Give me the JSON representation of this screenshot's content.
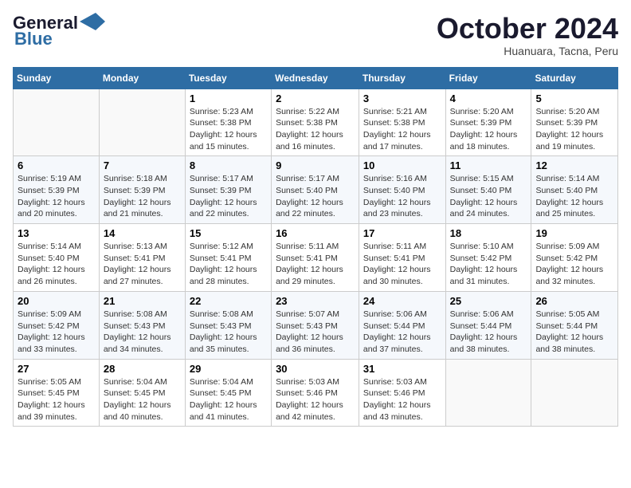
{
  "header": {
    "logo_line1": "General",
    "logo_line2": "Blue",
    "month": "October 2024",
    "location": "Huanuara, Tacna, Peru"
  },
  "weekdays": [
    "Sunday",
    "Monday",
    "Tuesday",
    "Wednesday",
    "Thursday",
    "Friday",
    "Saturday"
  ],
  "weeks": [
    [
      {
        "day": "",
        "sunrise": "",
        "sunset": "",
        "daylight": ""
      },
      {
        "day": "",
        "sunrise": "",
        "sunset": "",
        "daylight": ""
      },
      {
        "day": "1",
        "sunrise": "Sunrise: 5:23 AM",
        "sunset": "Sunset: 5:38 PM",
        "daylight": "Daylight: 12 hours and 15 minutes."
      },
      {
        "day": "2",
        "sunrise": "Sunrise: 5:22 AM",
        "sunset": "Sunset: 5:38 PM",
        "daylight": "Daylight: 12 hours and 16 minutes."
      },
      {
        "day": "3",
        "sunrise": "Sunrise: 5:21 AM",
        "sunset": "Sunset: 5:38 PM",
        "daylight": "Daylight: 12 hours and 17 minutes."
      },
      {
        "day": "4",
        "sunrise": "Sunrise: 5:20 AM",
        "sunset": "Sunset: 5:39 PM",
        "daylight": "Daylight: 12 hours and 18 minutes."
      },
      {
        "day": "5",
        "sunrise": "Sunrise: 5:20 AM",
        "sunset": "Sunset: 5:39 PM",
        "daylight": "Daylight: 12 hours and 19 minutes."
      }
    ],
    [
      {
        "day": "6",
        "sunrise": "Sunrise: 5:19 AM",
        "sunset": "Sunset: 5:39 PM",
        "daylight": "Daylight: 12 hours and 20 minutes."
      },
      {
        "day": "7",
        "sunrise": "Sunrise: 5:18 AM",
        "sunset": "Sunset: 5:39 PM",
        "daylight": "Daylight: 12 hours and 21 minutes."
      },
      {
        "day": "8",
        "sunrise": "Sunrise: 5:17 AM",
        "sunset": "Sunset: 5:39 PM",
        "daylight": "Daylight: 12 hours and 22 minutes."
      },
      {
        "day": "9",
        "sunrise": "Sunrise: 5:17 AM",
        "sunset": "Sunset: 5:40 PM",
        "daylight": "Daylight: 12 hours and 22 minutes."
      },
      {
        "day": "10",
        "sunrise": "Sunrise: 5:16 AM",
        "sunset": "Sunset: 5:40 PM",
        "daylight": "Daylight: 12 hours and 23 minutes."
      },
      {
        "day": "11",
        "sunrise": "Sunrise: 5:15 AM",
        "sunset": "Sunset: 5:40 PM",
        "daylight": "Daylight: 12 hours and 24 minutes."
      },
      {
        "day": "12",
        "sunrise": "Sunrise: 5:14 AM",
        "sunset": "Sunset: 5:40 PM",
        "daylight": "Daylight: 12 hours and 25 minutes."
      }
    ],
    [
      {
        "day": "13",
        "sunrise": "Sunrise: 5:14 AM",
        "sunset": "Sunset: 5:40 PM",
        "daylight": "Daylight: 12 hours and 26 minutes."
      },
      {
        "day": "14",
        "sunrise": "Sunrise: 5:13 AM",
        "sunset": "Sunset: 5:41 PM",
        "daylight": "Daylight: 12 hours and 27 minutes."
      },
      {
        "day": "15",
        "sunrise": "Sunrise: 5:12 AM",
        "sunset": "Sunset: 5:41 PM",
        "daylight": "Daylight: 12 hours and 28 minutes."
      },
      {
        "day": "16",
        "sunrise": "Sunrise: 5:11 AM",
        "sunset": "Sunset: 5:41 PM",
        "daylight": "Daylight: 12 hours and 29 minutes."
      },
      {
        "day": "17",
        "sunrise": "Sunrise: 5:11 AM",
        "sunset": "Sunset: 5:41 PM",
        "daylight": "Daylight: 12 hours and 30 minutes."
      },
      {
        "day": "18",
        "sunrise": "Sunrise: 5:10 AM",
        "sunset": "Sunset: 5:42 PM",
        "daylight": "Daylight: 12 hours and 31 minutes."
      },
      {
        "day": "19",
        "sunrise": "Sunrise: 5:09 AM",
        "sunset": "Sunset: 5:42 PM",
        "daylight": "Daylight: 12 hours and 32 minutes."
      }
    ],
    [
      {
        "day": "20",
        "sunrise": "Sunrise: 5:09 AM",
        "sunset": "Sunset: 5:42 PM",
        "daylight": "Daylight: 12 hours and 33 minutes."
      },
      {
        "day": "21",
        "sunrise": "Sunrise: 5:08 AM",
        "sunset": "Sunset: 5:43 PM",
        "daylight": "Daylight: 12 hours and 34 minutes."
      },
      {
        "day": "22",
        "sunrise": "Sunrise: 5:08 AM",
        "sunset": "Sunset: 5:43 PM",
        "daylight": "Daylight: 12 hours and 35 minutes."
      },
      {
        "day": "23",
        "sunrise": "Sunrise: 5:07 AM",
        "sunset": "Sunset: 5:43 PM",
        "daylight": "Daylight: 12 hours and 36 minutes."
      },
      {
        "day": "24",
        "sunrise": "Sunrise: 5:06 AM",
        "sunset": "Sunset: 5:44 PM",
        "daylight": "Daylight: 12 hours and 37 minutes."
      },
      {
        "day": "25",
        "sunrise": "Sunrise: 5:06 AM",
        "sunset": "Sunset: 5:44 PM",
        "daylight": "Daylight: 12 hours and 38 minutes."
      },
      {
        "day": "26",
        "sunrise": "Sunrise: 5:05 AM",
        "sunset": "Sunset: 5:44 PM",
        "daylight": "Daylight: 12 hours and 38 minutes."
      }
    ],
    [
      {
        "day": "27",
        "sunrise": "Sunrise: 5:05 AM",
        "sunset": "Sunset: 5:45 PM",
        "daylight": "Daylight: 12 hours and 39 minutes."
      },
      {
        "day": "28",
        "sunrise": "Sunrise: 5:04 AM",
        "sunset": "Sunset: 5:45 PM",
        "daylight": "Daylight: 12 hours and 40 minutes."
      },
      {
        "day": "29",
        "sunrise": "Sunrise: 5:04 AM",
        "sunset": "Sunset: 5:45 PM",
        "daylight": "Daylight: 12 hours and 41 minutes."
      },
      {
        "day": "30",
        "sunrise": "Sunrise: 5:03 AM",
        "sunset": "Sunset: 5:46 PM",
        "daylight": "Daylight: 12 hours and 42 minutes."
      },
      {
        "day": "31",
        "sunrise": "Sunrise: 5:03 AM",
        "sunset": "Sunset: 5:46 PM",
        "daylight": "Daylight: 12 hours and 43 minutes."
      },
      {
        "day": "",
        "sunrise": "",
        "sunset": "",
        "daylight": ""
      },
      {
        "day": "",
        "sunrise": "",
        "sunset": "",
        "daylight": ""
      }
    ]
  ]
}
